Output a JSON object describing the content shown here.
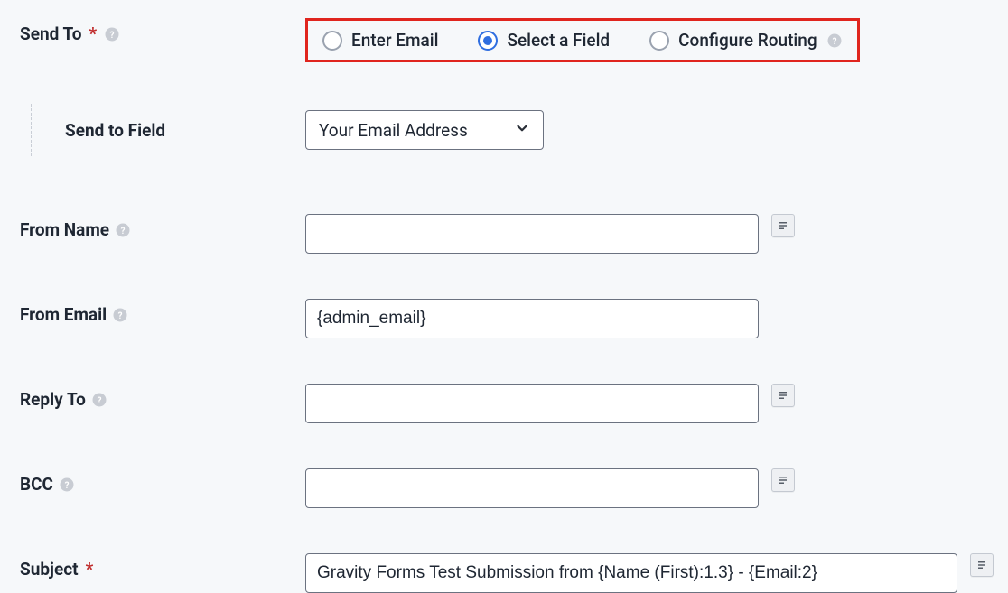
{
  "sendTo": {
    "label": "Send To",
    "required_mark": "*",
    "options": {
      "enterEmail": "Enter Email",
      "selectField": "Select a Field",
      "configureRouting": "Configure Routing"
    },
    "selected": "selectField"
  },
  "sendToField": {
    "label": "Send to Field",
    "selectedOption": "Your Email Address"
  },
  "fromName": {
    "label": "From Name",
    "value": ""
  },
  "fromEmail": {
    "label": "From Email",
    "value": "{admin_email}"
  },
  "replyTo": {
    "label": "Reply To",
    "value": ""
  },
  "bcc": {
    "label": "BCC",
    "value": ""
  },
  "subject": {
    "label": "Subject",
    "required_mark": "*",
    "value": "Gravity Forms Test Submission from {Name (First):1.3} - {Email:2}"
  }
}
